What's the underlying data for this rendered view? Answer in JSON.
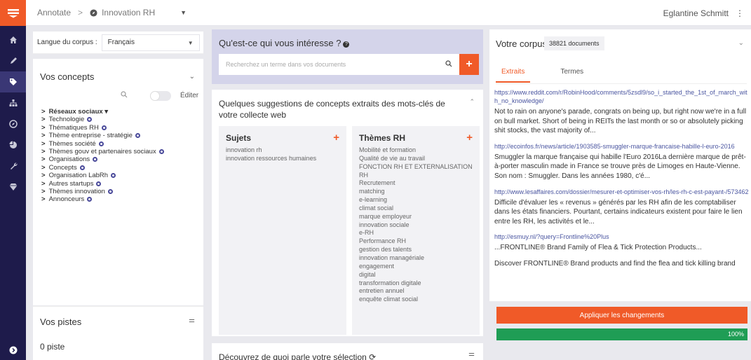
{
  "breadcrumb": {
    "root": "Annotate",
    "separator": ">",
    "project": "Innovation RH"
  },
  "user": {
    "name": "Eglantine Schmitt"
  },
  "sidebar_icons": [
    "home-icon",
    "pen-icon",
    "tag-icon",
    "hierarchy-icon",
    "compass-icon",
    "pie-icon",
    "wrench-icon",
    "gem-icon"
  ],
  "language": {
    "label": "Langue du corpus :",
    "value": "Français"
  },
  "concepts": {
    "title": "Vos concepts",
    "edit_label": "Éditer",
    "items": [
      {
        "label": "Réseaux sociaux ▾",
        "bold": true,
        "dot": false
      },
      {
        "label": "Technologie",
        "bold": false,
        "dot": true
      },
      {
        "label": "Thématiques RH",
        "bold": false,
        "dot": true
      },
      {
        "label": "Thème entreprise - stratégie",
        "bold": false,
        "dot": true
      },
      {
        "label": "Thèmes société",
        "bold": false,
        "dot": true
      },
      {
        "label": "Thèmes gouv et partenaires sociaux",
        "bold": false,
        "dot": true
      },
      {
        "label": "Organisations",
        "bold": false,
        "dot": true
      },
      {
        "label": "Concepts",
        "bold": false,
        "dot": true
      },
      {
        "label": "Organisation LabRh",
        "bold": false,
        "dot": true
      },
      {
        "label": "Autres startups",
        "bold": false,
        "dot": true
      },
      {
        "label": "Thèmes innovation",
        "bold": false,
        "dot": true
      },
      {
        "label": "Annonceurs",
        "bold": false,
        "dot": true
      }
    ]
  },
  "pistes": {
    "title": "Vos pistes",
    "value": "0 piste"
  },
  "search": {
    "question": "Qu'est-ce qui vous intéresse ?",
    "placeholder": "Recherchez un terme dans vos documents",
    "add_label": "+"
  },
  "suggestions": {
    "title": "Quelques suggestions de concepts extraits des mots-clés de votre collecte web",
    "cards": [
      {
        "title": "Sujets",
        "items": [
          "innovation rh",
          "innovation ressources humaines"
        ]
      },
      {
        "title": "Thèmes RH",
        "items": [
          "Mobilité et formation",
          "Qualité de vie au travail",
          "FONCTION RH ET EXTERNALISATION",
          "RH",
          "Recrutement",
          "matching",
          "e-learning",
          "climat social",
          "marque employeur",
          "innovation sociale",
          "e-RH",
          "Performance RH",
          "gestion des talents",
          "innovation managériale",
          "engagement",
          "digital",
          "transformation digitale",
          "entretien annuel",
          "enquête climat social"
        ]
      }
    ]
  },
  "discover": {
    "title": "Découvrez de quoi parle votre sélection"
  },
  "corpus": {
    "title": "Votre corpus",
    "count": "38821 documents",
    "tabs": [
      "Extraits",
      "Termes"
    ],
    "active_tab": "Extraits",
    "docs": [
      {
        "url": "https://www.reddit.com/r/RobinHood/comments/5zsdl9/so_i_started_the_1st_of_march_with_no_knowledge/",
        "excerpt": "Not to rain on anyone's parade, congrats on being up, but right now we're in a full on bull market. Short of being in REITs the last month or so or absolutely picking shit stocks, the vast majority of..."
      },
      {
        "url": "http://ecoinfos.fr/news/article/1903585-smuggler-marque-francaise-habille-l-euro-2016",
        "excerpt": "Smuggler la marque française qui habille l'Euro 2016La dernière marque de prêt-à-porter masculin made in France se trouve près de Limoges en Haute-Vienne. Son nom : Smuggler. Dans les années 1980, c'é..."
      },
      {
        "url": "http://www.lesaffaires.com/dossier/mesurer-et-optimiser-vos-rh/les-rh-c-est-payant-/573462",
        "excerpt": "Difficile d'évaluer les « revenus » générés par les RH afin de les comptabiliser dans les états financiers. Pourtant, certains indicateurs existent pour faire le lien entre les RH, les activités et le..."
      },
      {
        "url": "http://esmuy.nl/?query=Frontline%20Plus",
        "excerpt": "...FRONTLINE® Brand Family of Flea & Tick Protection Products..."
      },
      {
        "url": "",
        "excerpt": "Discover FRONTLINE® Brand products and find the flea and tick killing brand"
      }
    ]
  },
  "apply_label": "Appliquer les changements",
  "progress": {
    "value": 1.0,
    "label": "100%"
  },
  "colors": {
    "accent": "#f05a28",
    "rail": "#1e1b4b",
    "success": "#1f9d55",
    "link": "#4a55a0"
  }
}
